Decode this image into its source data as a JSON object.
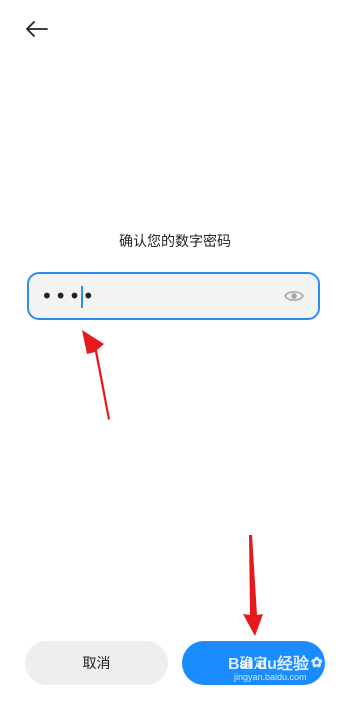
{
  "header": {
    "back_icon": "arrow-left-icon"
  },
  "title": "确认您的数字密码",
  "password": {
    "mask": "••••",
    "toggle_icon": "eye-icon"
  },
  "buttons": {
    "cancel": "取消",
    "confirm": "确定"
  },
  "colors": {
    "accent": "#1a8cff",
    "field_border": "#2d8cf0",
    "annotation": "#e8191b"
  },
  "watermark": {
    "brand": "Bai du经验",
    "paw": "✿",
    "sub": "jingyan.baidu.com"
  }
}
